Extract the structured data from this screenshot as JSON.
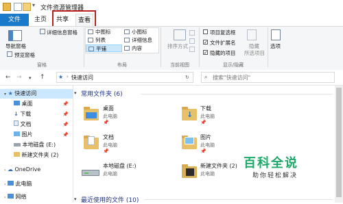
{
  "window": {
    "title": "文件资源管理器"
  },
  "tabs": [
    "文件",
    "主页",
    "共享",
    "查看"
  ],
  "ribbon": {
    "nav_pane": "导航窗格",
    "preview_pane": "预览窗格",
    "details_pane": "详细信息窗格",
    "group_panes": "窗格",
    "layout": {
      "medium_icons": "中图标",
      "small_icons": "小图标",
      "list": "列表",
      "details": "详细信息",
      "tiles": "平铺",
      "content": "内容"
    },
    "group_layout": "布局",
    "sort_by": "排序方式",
    "group_current_view": "当前视图",
    "item_checkboxes": "项目复选框",
    "file_extensions": "文件扩展名",
    "hidden_items": "隐藏的项目",
    "hide_selected_1": "隐藏",
    "hide_selected_2": "所选项目",
    "group_show_hide": "显示/隐藏",
    "options": "选项"
  },
  "address": {
    "path": "快速访问",
    "search_placeholder": "搜索\"快速访问\""
  },
  "nav": {
    "quick_access": "快速访问",
    "items": [
      "桌面",
      "下载",
      "文档",
      "图片",
      "本地磁盘 (E:)",
      "新建文件夹 (2)"
    ],
    "onedrive": "OneDrive",
    "this_pc": "此电脑",
    "network": "网络"
  },
  "content": {
    "frequent_header": "常用文件夹 (6)",
    "recent_header": "最近使用的文件 (10)",
    "items": [
      {
        "name": "桌面",
        "sub": "此电脑"
      },
      {
        "name": "下载",
        "sub": "此电脑"
      },
      {
        "name": "文档",
        "sub": "此电脑"
      },
      {
        "name": "图片",
        "sub": "此电脑"
      },
      {
        "name": "本地磁盘 (E:)",
        "sub": "此电脑"
      },
      {
        "name": "新建文件夹 (2)",
        "sub": "此电脑"
      }
    ]
  },
  "watermark": {
    "title": "百科全说",
    "subtitle": "助你轻松解决"
  },
  "colors": {
    "accent": "#1979ca",
    "highlight_box": "#b81f1f",
    "watermark": "#1da86a"
  }
}
